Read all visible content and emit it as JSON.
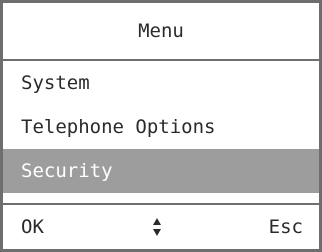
{
  "menu": {
    "title": "Menu",
    "items": [
      {
        "label": "System",
        "selected": false
      },
      {
        "label": "Telephone Options",
        "selected": false
      },
      {
        "label": "Security",
        "selected": true
      }
    ]
  },
  "softkeys": {
    "left_label": "OK",
    "right_label": "Esc",
    "center_icon": "up-down-scroll-icon"
  },
  "colors": {
    "selection_background": "#9d9d9d",
    "border": "#6e6e6e",
    "text": "#2a2a2a"
  }
}
